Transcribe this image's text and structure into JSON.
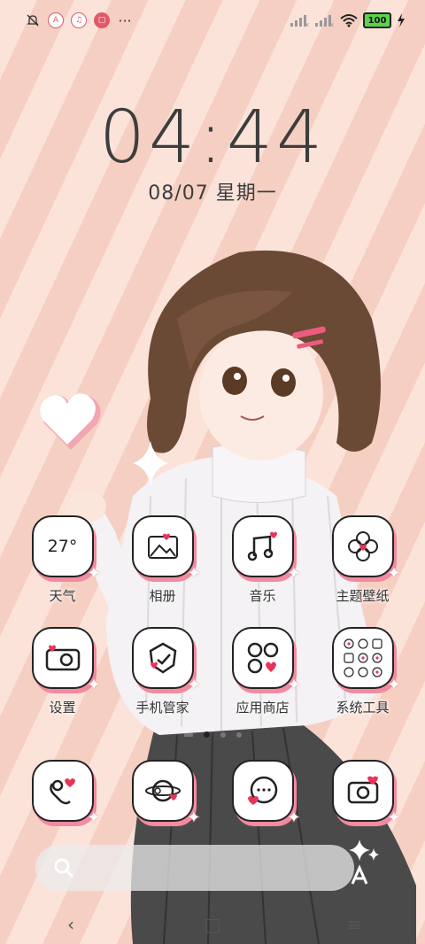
{
  "status_bar": {
    "left_icons": [
      "bell-off-icon",
      "app-a-icon",
      "app-music-icon",
      "app-red-icon",
      "more-dots-icon"
    ],
    "more_label": "···",
    "battery": "100",
    "right_icons": [
      "signal-icon",
      "signal-icon",
      "wifi-icon",
      "battery-icon",
      "charging-icon"
    ]
  },
  "lockclock": {
    "time": "04:44",
    "date": "08/07 星期一"
  },
  "apps": [
    {
      "label": "天气",
      "icon": "weather-icon",
      "icon_text": "27°"
    },
    {
      "label": "相册",
      "icon": "gallery-icon"
    },
    {
      "label": "音乐",
      "icon": "music-icon"
    },
    {
      "label": "主题壁纸",
      "icon": "theme-icon"
    },
    {
      "label": "设置",
      "icon": "settings-camera-icon"
    },
    {
      "label": "手机管家",
      "icon": "security-icon"
    },
    {
      "label": "应用商店",
      "icon": "app-store-icon"
    },
    {
      "label": "系统工具",
      "icon": "system-tools-folder-icon"
    }
  ],
  "dock": [
    {
      "icon": "phone-icon"
    },
    {
      "icon": "browser-icon"
    },
    {
      "icon": "messages-icon"
    },
    {
      "icon": "camera-icon"
    }
  ],
  "page_indicator": {
    "pages": 3,
    "active": 1
  },
  "search": {
    "icon": "search-icon"
  },
  "navbar": {
    "back": "‹",
    "home": "□",
    "menu": "≡"
  },
  "colors": {
    "accent_pink": "#f28aa0",
    "heart_red": "#e8345a",
    "stripe_light": "#fbe3da",
    "stripe_dark": "#f6cfc3"
  }
}
